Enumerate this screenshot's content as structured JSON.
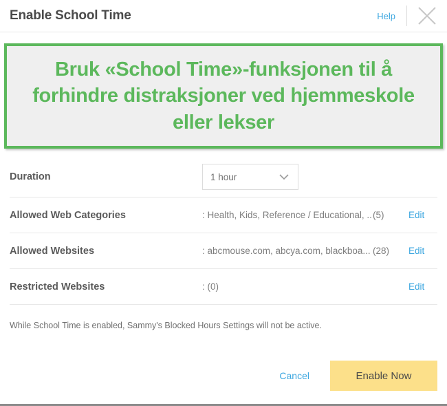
{
  "header": {
    "title": "Enable School Time",
    "help_label": "Help",
    "close_icon": "close-icon"
  },
  "promo": {
    "text": "Bruk «School Time»-funksjonen til å forhindre distraksjoner ved hjemmeskole eller lekser",
    "text_color": "#5cb85c",
    "border_color": "#5cb85c",
    "background_color": "#efefef"
  },
  "duration": {
    "label": "Duration",
    "selected": "1 hour",
    "arrow_icon": "chevron-down-icon"
  },
  "settings_rows": [
    {
      "label": "Allowed Web Categories",
      "value": ": Health, Kids, Reference / Educational, ...",
      "count": "(5)",
      "edit_label": "Edit"
    },
    {
      "label": "Allowed Websites",
      "value": ": abcmouse.com, abcya.com, blackboa...",
      "count": "(28)",
      "edit_label": "Edit"
    },
    {
      "label": "Restricted Websites",
      "value": ": (0)",
      "count": "",
      "edit_label": "Edit"
    }
  ],
  "note": "While School Time is enabled, Sammy's Blocked Hours Settings will not be active.",
  "footer": {
    "cancel_label": "Cancel",
    "enable_label": "Enable Now",
    "enable_color": "#fce08a"
  },
  "link_color": "#3da7e0"
}
